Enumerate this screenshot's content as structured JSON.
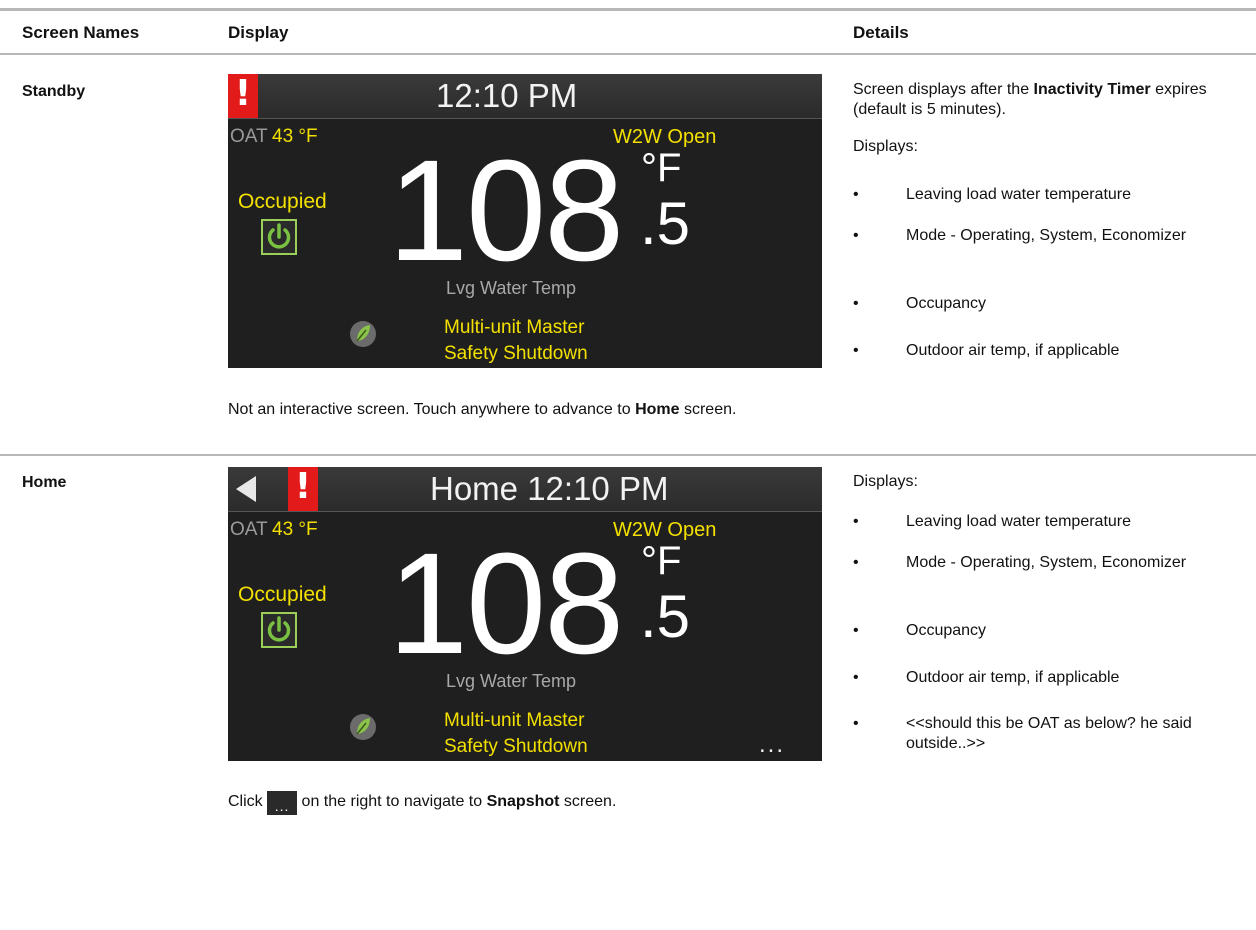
{
  "headers": {
    "col1": "Screen Names",
    "col2": "Display",
    "col3": "Details"
  },
  "rows": [
    {
      "name": "Standby",
      "screen": {
        "alert": "!",
        "time": "12:10 PM",
        "oat_label": "OAT",
        "oat_value": "43 °F",
        "w2w": "W2W Open",
        "occupancy": "Occupied",
        "temp": "108",
        "unit": "°F",
        "decimal": ".5",
        "temp_label": "Lvg Water Temp",
        "mode_line1": "Multi-unit Master",
        "mode_line2": "Safety Shutdown"
      },
      "note_pre": "Not an interactive screen. Touch anywhere to advance to ",
      "note_bold": "Home",
      "note_post": " screen.",
      "details_intro_pre": "Screen displays after the ",
      "details_intro_bold": "Inactivity Timer",
      "details_intro_post": " expires (default is 5 minutes).",
      "displays_label": "Displays:",
      "bullets": [
        "Leaving load water temperature",
        "Mode - Operating, System, Economizer",
        "Occupancy",
        "Outdoor air temp, if applicable"
      ]
    },
    {
      "name": "Home",
      "screen": {
        "alert": "!",
        "time": "Home 12:10 PM",
        "oat_label": "OAT",
        "oat_value": "43 °F",
        "w2w": "W2W Open",
        "occupancy": "Occupied",
        "temp": "108",
        "unit": "°F",
        "decimal": ".5",
        "temp_label": "Lvg Water Temp",
        "mode_line1": "Multi-unit Master",
        "mode_line2": "Safety Shutdown",
        "more": "..."
      },
      "note_pre": "Click ",
      "note_icon": "...",
      "note_mid": " on the right to navigate to ",
      "note_bold": "Snapshot",
      "note_post": " screen.",
      "displays_label": "Displays:",
      "bullets": [
        "Leaving load water temperature",
        "Mode - Operating, System, Economizer",
        "Occupancy",
        "Outdoor air temp, if applicable",
        "<<should this be OAT as below? he said outside..>>"
      ]
    }
  ],
  "icons": {
    "power": "power-icon",
    "leaf": "leaf-icon",
    "back": "back-arrow-icon",
    "alert": "alert-icon"
  },
  "colors": {
    "alert": "#e21a1a",
    "status_yellow": "#f3e000",
    "power_green": "#7ac142",
    "screen_bg": "#1f1f1f"
  }
}
